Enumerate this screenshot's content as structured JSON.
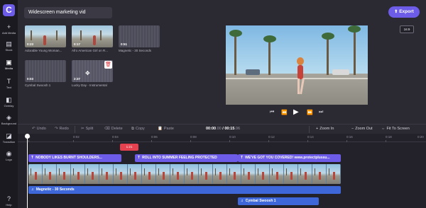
{
  "sidebar": {
    "logo": "C",
    "items": [
      {
        "label": "Add Media",
        "icon": "plus-icon",
        "glyph": "+"
      },
      {
        "label": "Stock",
        "icon": "stock-icon",
        "glyph": "▤"
      },
      {
        "label": "Media",
        "icon": "media-icon",
        "glyph": "▣"
      },
      {
        "label": "Text",
        "icon": "text-icon",
        "glyph": "T"
      },
      {
        "label": "Overlay",
        "icon": "overlay-icon",
        "glyph": "◧"
      },
      {
        "label": "Background",
        "icon": "background-icon",
        "glyph": "◈"
      },
      {
        "label": "Transition",
        "icon": "transition-icon",
        "glyph": "◪"
      },
      {
        "label": "Logo",
        "icon": "logo-icon",
        "glyph": "◉"
      },
      {
        "label": "Help",
        "icon": "help-icon",
        "glyph": "?"
      }
    ]
  },
  "header": {
    "project_title": "Widescreen marketing vid",
    "export_label": "Export",
    "aspect_ratio": "16:9"
  },
  "media": [
    {
      "duration": "0:23",
      "caption": "Adorable Young Woman...",
      "kind": "video"
    },
    {
      "duration": "0:17",
      "caption": "Afro American Girl on R...",
      "kind": "video"
    },
    {
      "duration": "0:51",
      "caption": "Magnetic - 30 Seconds",
      "kind": "audio"
    },
    {
      "duration": "0:03",
      "caption": "Cymbal Swoosh 1",
      "kind": "audio"
    },
    {
      "duration": "2:37",
      "caption": "Lucky Day - Instrumental",
      "kind": "audio"
    }
  ],
  "playback": {
    "skip_back": "⏮",
    "step_back": "⏪",
    "play": "▶",
    "step_forward": "⏩",
    "skip_forward": "⏭"
  },
  "toolbar": {
    "undo": "Undo",
    "redo": "Redo",
    "split": "Split",
    "delete": "Delete",
    "copy": "Copy",
    "paste": "Paste",
    "current_time": "00:00",
    "current_frac": ".00",
    "total_time": "00:15",
    "total_frac": ".06",
    "zoom_in": "Zoom In",
    "zoom_out": "Zoom Out",
    "fit": "Fit To Screen"
  },
  "timeline": {
    "ticks": [
      "0",
      "0:02",
      "0:04",
      "0:06",
      "0:08",
      "0:10",
      "0:12",
      "0:14",
      "0:16",
      "0:18",
      "0:20"
    ],
    "sticker_label": "1:21",
    "text_clips": [
      "NOBODY LIKES BURNT SHOULDERS...",
      "ROLL INTO SUMMER FEELING PROTECTED",
      "WE'VE GOT YOU COVERED! www.protectplussu..."
    ],
    "audio_clips": [
      "Magnetic - 30 Seconds",
      "Cymbal Swoosh 1"
    ]
  },
  "colors": {
    "accent": "#6c5ce7",
    "audio": "#3e68d9",
    "sticker": "#e5414e",
    "background": "#2b2a33"
  }
}
